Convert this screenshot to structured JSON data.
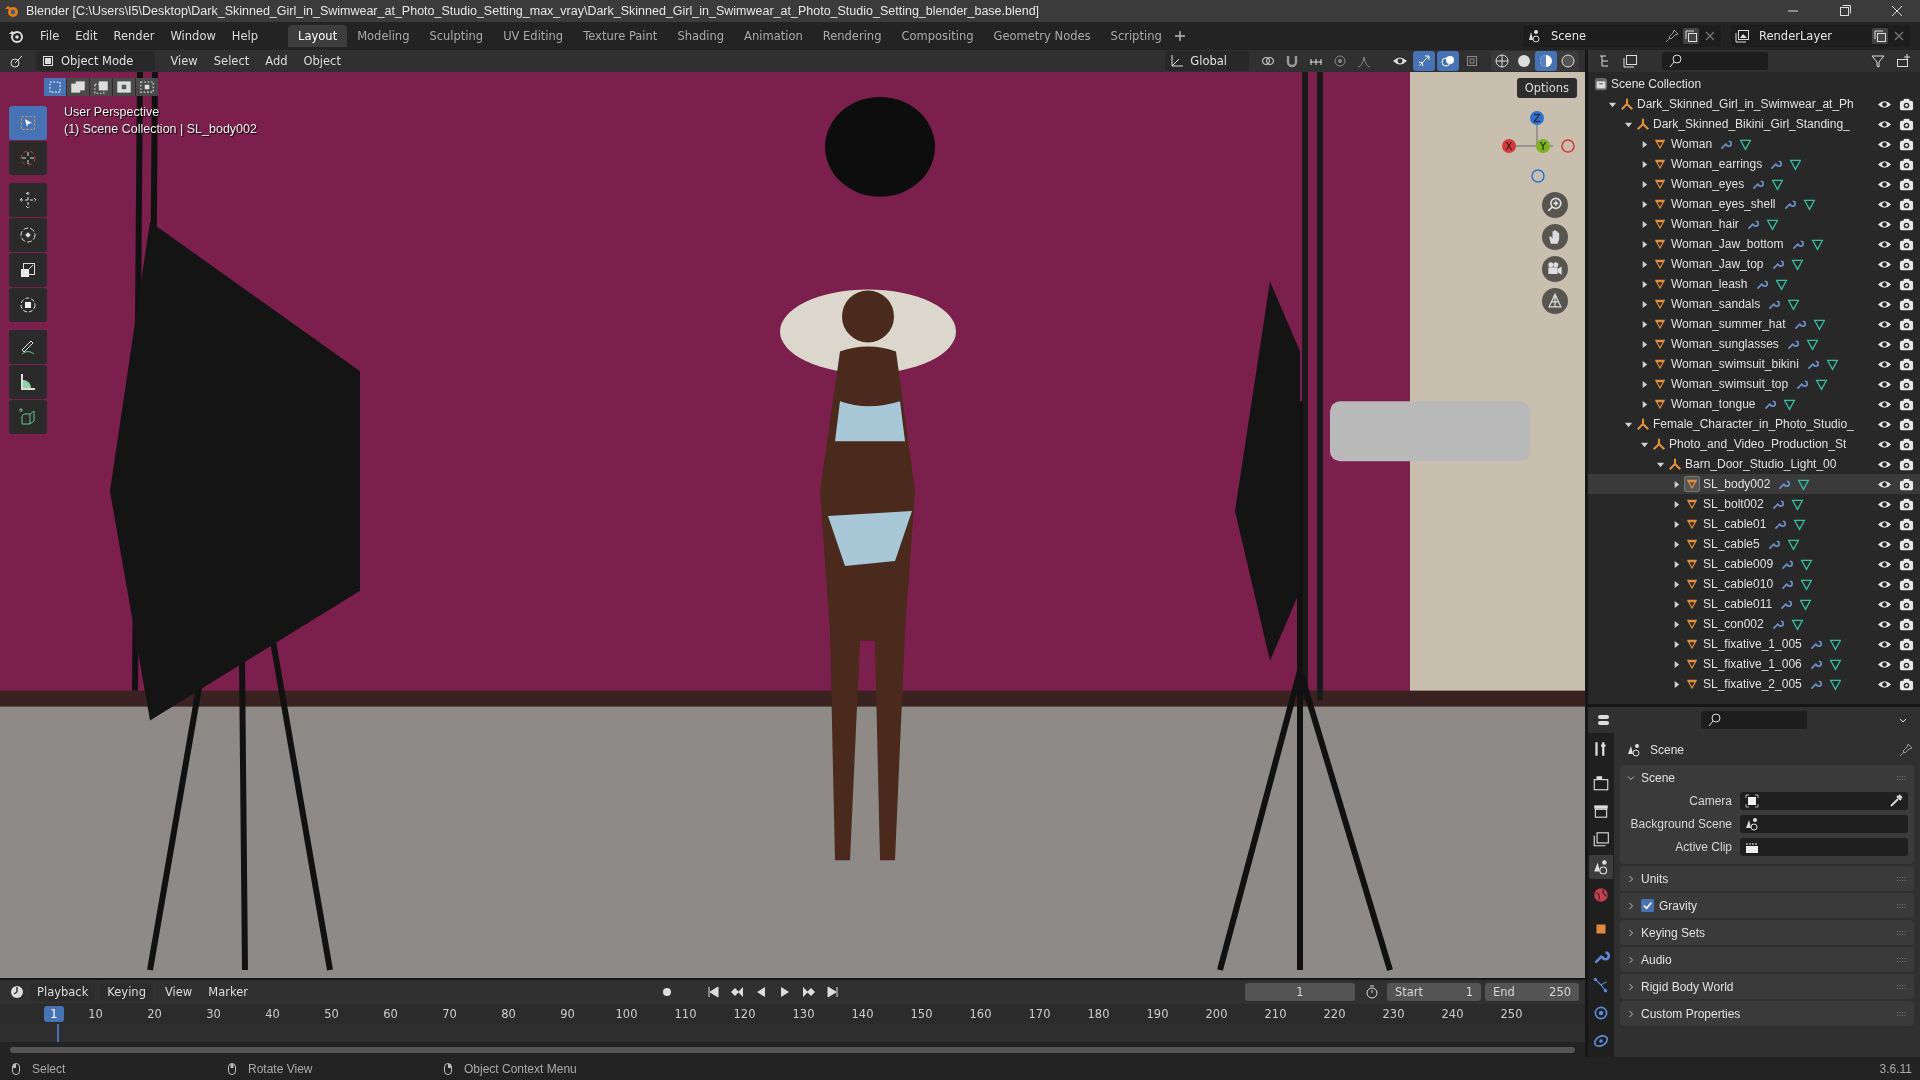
{
  "window": {
    "title": "Blender [C:\\Users\\I5\\Desktop\\Dark_Skinned_Girl_in_Swimwear_at_Photo_Studio_Setting_max_vray\\Dark_Skinned_Girl_in_Swimwear_at_Photo_Studio_Setting_blender_base.blend]"
  },
  "menu": [
    "File",
    "Edit",
    "Render",
    "Window",
    "Help"
  ],
  "workspaces": [
    {
      "label": "Layout",
      "selected": true
    },
    {
      "label": "Modeling",
      "selected": false
    },
    {
      "label": "Sculpting",
      "selected": false
    },
    {
      "label": "UV Editing",
      "selected": false
    },
    {
      "label": "Texture Paint",
      "selected": false
    },
    {
      "label": "Shading",
      "selected": false
    },
    {
      "label": "Animation",
      "selected": false
    },
    {
      "label": "Rendering",
      "selected": false
    },
    {
      "label": "Compositing",
      "selected": false
    },
    {
      "label": "Geometry Nodes",
      "selected": false
    },
    {
      "label": "Scripting",
      "selected": false
    }
  ],
  "scene_selector": {
    "value": "Scene"
  },
  "view_layer": {
    "value": "RenderLayer"
  },
  "viewport_header": {
    "mode": "Object Mode",
    "menus": [
      "View",
      "Select",
      "Add",
      "Object"
    ],
    "orientation": "Global",
    "toggles": [
      {
        "kind": "gizmo",
        "on": true
      },
      {
        "kind": "overlay",
        "on": true
      },
      {
        "kind": "xray",
        "on": false
      }
    ],
    "shading": [
      {
        "kind": "wire",
        "selected": false
      },
      {
        "kind": "solid",
        "selected": false
      },
      {
        "kind": "material",
        "selected": true
      },
      {
        "kind": "rendered",
        "selected": false
      }
    ]
  },
  "viewport": {
    "view_name": "User Perspective",
    "context": "(1) Scene Collection | SL_body002",
    "options": "Options",
    "gizmo": [
      "X",
      "Y",
      "Z"
    ],
    "select_modes": [
      {
        "selected": true
      },
      {
        "selected": false
      },
      {
        "selected": false
      },
      {
        "selected": false
      },
      {
        "selected": false
      }
    ],
    "tools": [
      {
        "kind": "select",
        "selected": true
      },
      {
        "kind": "cursor",
        "selected": false
      },
      {
        "kind": "move",
        "selected": false
      },
      {
        "kind": "rotate",
        "selected": false
      },
      {
        "kind": "scale",
        "selected": false
      },
      {
        "kind": "transform",
        "selected": false
      },
      {
        "kind": "annotate",
        "selected": false
      },
      {
        "kind": "measure",
        "selected": false
      },
      {
        "kind": "add",
        "selected": false
      }
    ]
  },
  "outliner": {
    "root": "Scene Collection",
    "items": [
      {
        "name": "Dark_Skinned_Girl_in_Swimwear_at_Ph",
        "kind": "collection",
        "expanded": true,
        "selected": false,
        "children": [
          {
            "name": "Dark_Skinned_Bikini_Girl_Standing_",
            "kind": "collection",
            "expanded": true,
            "selected": false,
            "children": [
              {
                "name": "Woman",
                "kind": "mesh",
                "expanded": false,
                "selected": false
              },
              {
                "name": "Woman_earrings",
                "kind": "mesh",
                "expanded": false,
                "selected": false
              },
              {
                "name": "Woman_eyes",
                "kind": "mesh",
                "expanded": false,
                "selected": false
              },
              {
                "name": "Woman_eyes_shell",
                "kind": "mesh",
                "expanded": false,
                "selected": false
              },
              {
                "name": "Woman_hair",
                "kind": "mesh",
                "expanded": false,
                "selected": false
              },
              {
                "name": "Woman_Jaw_bottom",
                "kind": "mesh",
                "expanded": false,
                "selected": false
              },
              {
                "name": "Woman_Jaw_top",
                "kind": "mesh",
                "expanded": false,
                "selected": false
              },
              {
                "name": "Woman_leash",
                "kind": "mesh",
                "expanded": false,
                "selected": false
              },
              {
                "name": "Woman_sandals",
                "kind": "mesh",
                "expanded": false,
                "selected": false
              },
              {
                "name": "Woman_summer_hat",
                "kind": "mesh",
                "expanded": false,
                "selected": false
              },
              {
                "name": "Woman_sunglasses",
                "kind": "mesh",
                "expanded": false,
                "selected": false
              },
              {
                "name": "Woman_swimsuit_bikini",
                "kind": "mesh",
                "expanded": false,
                "selected": false
              },
              {
                "name": "Woman_swimsuit_top",
                "kind": "mesh",
                "expanded": false,
                "selected": false
              },
              {
                "name": "Woman_tongue",
                "kind": "mesh",
                "expanded": false,
                "selected": false
              }
            ]
          },
          {
            "name": "Female_Character_in_Photo_Studio_",
            "kind": "collection",
            "expanded": true,
            "selected": false,
            "children": [
              {
                "name": "Photo_and_Video_Production_St",
                "kind": "collection",
                "expanded": true,
                "selected": false,
                "children": [
                  {
                    "name": "Barn_Door_Studio_Light_00",
                    "kind": "collection",
                    "expanded": true,
                    "selected": false,
                    "children": [
                      {
                        "name": "SL_body002",
                        "kind": "mesh",
                        "expanded": false,
                        "selected": true
                      },
                      {
                        "name": "SL_bolt002",
                        "kind": "mesh",
                        "expanded": false,
                        "selected": false
                      },
                      {
                        "name": "SL_cable01",
                        "kind": "mesh",
                        "expanded": false,
                        "selected": false
                      },
                      {
                        "name": "SL_cable5",
                        "kind": "mesh",
                        "expanded": false,
                        "selected": false
                      },
                      {
                        "name": "SL_cable009",
                        "kind": "mesh",
                        "expanded": false,
                        "selected": false
                      },
                      {
                        "name": "SL_cable010",
                        "kind": "mesh",
                        "expanded": false,
                        "selected": false
                      },
                      {
                        "name": "SL_cable011",
                        "kind": "mesh",
                        "expanded": false,
                        "selected": false
                      },
                      {
                        "name": "SL_con002",
                        "kind": "mesh",
                        "expanded": false,
                        "selected": false
                      },
                      {
                        "name": "SL_fixative_1_005",
                        "kind": "mesh",
                        "expanded": false,
                        "selected": false
                      },
                      {
                        "name": "SL_fixative_1_006",
                        "kind": "mesh",
                        "expanded": false,
                        "selected": false
                      },
                      {
                        "name": "SL_fixative_2_005",
                        "kind": "mesh",
                        "expanded": false,
                        "selected": false
                      }
                    ]
                  }
                ]
              }
            ]
          }
        ]
      }
    ]
  },
  "properties": {
    "context": "Scene",
    "tabs": [
      {
        "kind": "tool",
        "selected": false
      },
      {
        "kind": "render",
        "selected": false
      },
      {
        "kind": "output",
        "selected": false
      },
      {
        "kind": "view_layer",
        "selected": false
      },
      {
        "kind": "scene",
        "selected": true
      },
      {
        "kind": "world",
        "selected": false
      },
      {
        "kind": "object",
        "selected": false
      },
      {
        "kind": "modifier",
        "selected": false
      },
      {
        "kind": "particles",
        "selected": false
      },
      {
        "kind": "physics",
        "selected": false
      },
      {
        "kind": "constraints",
        "selected": false
      }
    ],
    "panels": [
      {
        "title": "Scene",
        "expanded": true,
        "fields": [
          {
            "label": "Camera",
            "kind": "camera"
          },
          {
            "label": "Background Scene",
            "kind": "scene"
          },
          {
            "label": "Active Clip",
            "kind": "clip"
          }
        ]
      },
      {
        "title": "Units",
        "expanded": false
      },
      {
        "title": "Gravity",
        "expanded": false,
        "checked": true
      },
      {
        "title": "Keying Sets",
        "expanded": false
      },
      {
        "title": "Audio",
        "expanded": false
      },
      {
        "title": "Rigid Body World",
        "expanded": false
      },
      {
        "title": "Custom Properties",
        "expanded": false
      }
    ]
  },
  "timeline": {
    "menus": [
      "Playback",
      "Keying",
      "View",
      "Marker"
    ],
    "current_frame": "1",
    "start_label": "Start",
    "start": "1",
    "end_label": "End",
    "end": "250",
    "playhead": "1",
    "ruler": [
      "10",
      "20",
      "30",
      "40",
      "50",
      "60",
      "70",
      "80",
      "90",
      "100",
      "110",
      "120",
      "130",
      "140",
      "150",
      "160",
      "170",
      "180",
      "190",
      "200",
      "210",
      "220",
      "230",
      "240",
      "250"
    ]
  },
  "status_bar": {
    "hints": [
      "Select",
      "Rotate View",
      "Object Context Menu"
    ],
    "version": "3.6.11"
  }
}
